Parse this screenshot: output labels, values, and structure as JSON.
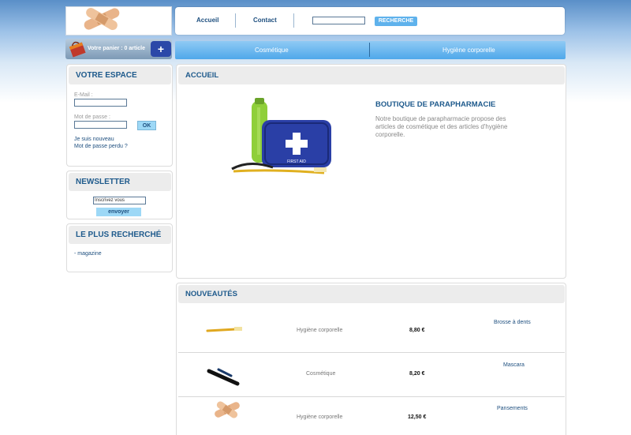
{
  "header": {
    "nav": [
      "Accueil",
      "Contact"
    ],
    "search_placeholder": "",
    "search_button": "RECHERCHE",
    "cart_text": "Votre panier : 0 article",
    "categories": [
      "Cosmétique",
      "Hygiène corporelle"
    ]
  },
  "sidebar": {
    "espace": {
      "title": "VOTRE ESPACE",
      "email_label": "E-Mail :",
      "password_label": "Mot de passe :",
      "ok_label": "OK",
      "new_link": "Je suis nouveau",
      "lost_link": "Mot de passe perdu ?"
    },
    "newsletter": {
      "title": "NEWSLETTER",
      "input_value": "Inscrivez vous",
      "button": "envoyer"
    },
    "popular": {
      "title": "LE PLUS RECHERCHÉ",
      "items": [
        "- magazine"
      ]
    }
  },
  "main": {
    "accueil_title": "ACCUEIL",
    "shop_title": "BOUTIQUE DE PARAPHARMACIE",
    "shop_description": "Notre boutique de parapharmacie propose des articles de cosmétique et des articles d'hygiène corporelle.",
    "image_label": "FIRST AID",
    "nouveautes_title": "NOUVEAUTÉS",
    "products": [
      {
        "category": "Hygiène corporelle",
        "price": "8,80 €",
        "name": "Brosse à dents"
      },
      {
        "category": "Cosmétique",
        "price": "8,20 €",
        "name": "Mascara"
      },
      {
        "category": "Hygiène corporelle",
        "price": "12,50 €",
        "name": "Pansements"
      }
    ]
  }
}
